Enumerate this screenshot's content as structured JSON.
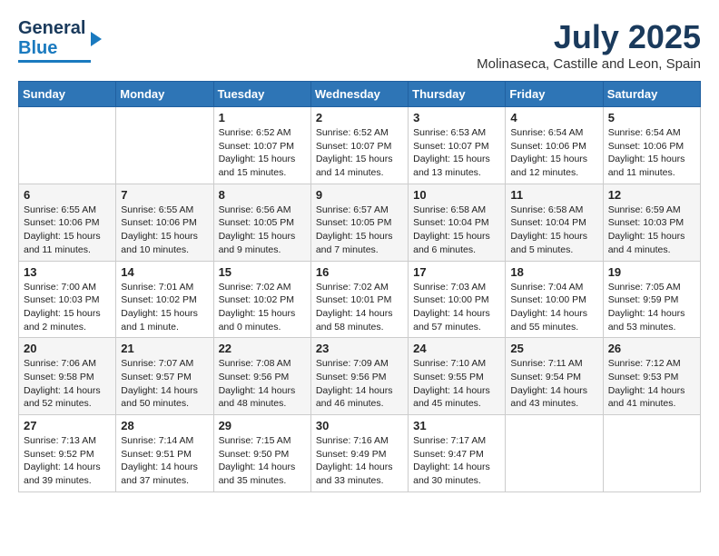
{
  "header": {
    "logo_general": "General",
    "logo_blue": "Blue",
    "month_year": "July 2025",
    "location": "Molinaseca, Castille and Leon, Spain"
  },
  "weekdays": [
    "Sunday",
    "Monday",
    "Tuesday",
    "Wednesday",
    "Thursday",
    "Friday",
    "Saturday"
  ],
  "weeks": [
    [
      {
        "day": "",
        "content": ""
      },
      {
        "day": "",
        "content": ""
      },
      {
        "day": "1",
        "content": "Sunrise: 6:52 AM\nSunset: 10:07 PM\nDaylight: 15 hours\nand 15 minutes."
      },
      {
        "day": "2",
        "content": "Sunrise: 6:52 AM\nSunset: 10:07 PM\nDaylight: 15 hours\nand 14 minutes."
      },
      {
        "day": "3",
        "content": "Sunrise: 6:53 AM\nSunset: 10:07 PM\nDaylight: 15 hours\nand 13 minutes."
      },
      {
        "day": "4",
        "content": "Sunrise: 6:54 AM\nSunset: 10:06 PM\nDaylight: 15 hours\nand 12 minutes."
      },
      {
        "day": "5",
        "content": "Sunrise: 6:54 AM\nSunset: 10:06 PM\nDaylight: 15 hours\nand 11 minutes."
      }
    ],
    [
      {
        "day": "6",
        "content": "Sunrise: 6:55 AM\nSunset: 10:06 PM\nDaylight: 15 hours\nand 11 minutes."
      },
      {
        "day": "7",
        "content": "Sunrise: 6:55 AM\nSunset: 10:06 PM\nDaylight: 15 hours\nand 10 minutes."
      },
      {
        "day": "8",
        "content": "Sunrise: 6:56 AM\nSunset: 10:05 PM\nDaylight: 15 hours\nand 9 minutes."
      },
      {
        "day": "9",
        "content": "Sunrise: 6:57 AM\nSunset: 10:05 PM\nDaylight: 15 hours\nand 7 minutes."
      },
      {
        "day": "10",
        "content": "Sunrise: 6:58 AM\nSunset: 10:04 PM\nDaylight: 15 hours\nand 6 minutes."
      },
      {
        "day": "11",
        "content": "Sunrise: 6:58 AM\nSunset: 10:04 PM\nDaylight: 15 hours\nand 5 minutes."
      },
      {
        "day": "12",
        "content": "Sunrise: 6:59 AM\nSunset: 10:03 PM\nDaylight: 15 hours\nand 4 minutes."
      }
    ],
    [
      {
        "day": "13",
        "content": "Sunrise: 7:00 AM\nSunset: 10:03 PM\nDaylight: 15 hours\nand 2 minutes."
      },
      {
        "day": "14",
        "content": "Sunrise: 7:01 AM\nSunset: 10:02 PM\nDaylight: 15 hours\nand 1 minute."
      },
      {
        "day": "15",
        "content": "Sunrise: 7:02 AM\nSunset: 10:02 PM\nDaylight: 15 hours\nand 0 minutes."
      },
      {
        "day": "16",
        "content": "Sunrise: 7:02 AM\nSunset: 10:01 PM\nDaylight: 14 hours\nand 58 minutes."
      },
      {
        "day": "17",
        "content": "Sunrise: 7:03 AM\nSunset: 10:00 PM\nDaylight: 14 hours\nand 57 minutes."
      },
      {
        "day": "18",
        "content": "Sunrise: 7:04 AM\nSunset: 10:00 PM\nDaylight: 14 hours\nand 55 minutes."
      },
      {
        "day": "19",
        "content": "Sunrise: 7:05 AM\nSunset: 9:59 PM\nDaylight: 14 hours\nand 53 minutes."
      }
    ],
    [
      {
        "day": "20",
        "content": "Sunrise: 7:06 AM\nSunset: 9:58 PM\nDaylight: 14 hours\nand 52 minutes."
      },
      {
        "day": "21",
        "content": "Sunrise: 7:07 AM\nSunset: 9:57 PM\nDaylight: 14 hours\nand 50 minutes."
      },
      {
        "day": "22",
        "content": "Sunrise: 7:08 AM\nSunset: 9:56 PM\nDaylight: 14 hours\nand 48 minutes."
      },
      {
        "day": "23",
        "content": "Sunrise: 7:09 AM\nSunset: 9:56 PM\nDaylight: 14 hours\nand 46 minutes."
      },
      {
        "day": "24",
        "content": "Sunrise: 7:10 AM\nSunset: 9:55 PM\nDaylight: 14 hours\nand 45 minutes."
      },
      {
        "day": "25",
        "content": "Sunrise: 7:11 AM\nSunset: 9:54 PM\nDaylight: 14 hours\nand 43 minutes."
      },
      {
        "day": "26",
        "content": "Sunrise: 7:12 AM\nSunset: 9:53 PM\nDaylight: 14 hours\nand 41 minutes."
      }
    ],
    [
      {
        "day": "27",
        "content": "Sunrise: 7:13 AM\nSunset: 9:52 PM\nDaylight: 14 hours\nand 39 minutes."
      },
      {
        "day": "28",
        "content": "Sunrise: 7:14 AM\nSunset: 9:51 PM\nDaylight: 14 hours\nand 37 minutes."
      },
      {
        "day": "29",
        "content": "Sunrise: 7:15 AM\nSunset: 9:50 PM\nDaylight: 14 hours\nand 35 minutes."
      },
      {
        "day": "30",
        "content": "Sunrise: 7:16 AM\nSunset: 9:49 PM\nDaylight: 14 hours\nand 33 minutes."
      },
      {
        "day": "31",
        "content": "Sunrise: 7:17 AM\nSunset: 9:47 PM\nDaylight: 14 hours\nand 30 minutes."
      },
      {
        "day": "",
        "content": ""
      },
      {
        "day": "",
        "content": ""
      }
    ]
  ]
}
